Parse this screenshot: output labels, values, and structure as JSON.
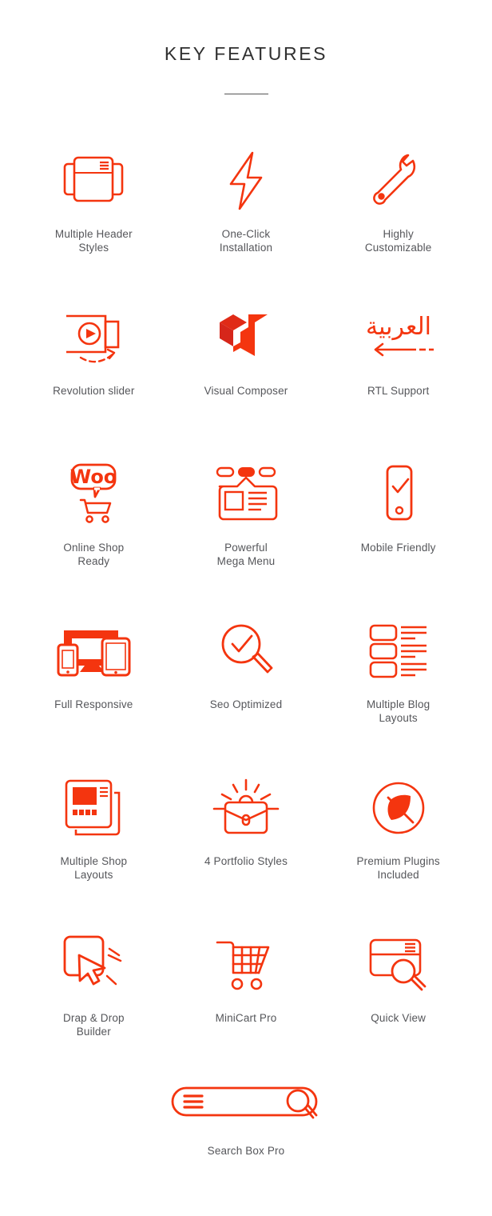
{
  "header": {
    "title": "KEY FEATURES"
  },
  "colors": {
    "accent": "#f4350f",
    "accent_dark": "#e8330f",
    "accent_light": "#ff4d17",
    "title": "#2f2f2f",
    "label": "#55565a",
    "background": "#ffffff"
  },
  "features": [
    {
      "id": "multiple-header-styles",
      "icon": "layout-stack-icon",
      "label": "Multiple Header\nStyles"
    },
    {
      "id": "one-click-installation",
      "icon": "lightning-bolt-icon",
      "label": "One-Click\nInstallation"
    },
    {
      "id": "highly-customizable",
      "icon": "wrench-icon",
      "label": "Highly\nCustomizable"
    },
    {
      "id": "revolution-slider",
      "icon": "slider-play-icon",
      "label": "Revolution slider"
    },
    {
      "id": "visual-composer",
      "icon": "visual-composer-logo-icon",
      "label": "Visual Composer"
    },
    {
      "id": "rtl-support",
      "icon": "arabic-rtl-arrow-icon",
      "label": "RTL Support"
    },
    {
      "id": "online-shop-ready",
      "icon": "woocommerce-cart-icon",
      "label": "Online Shop\nReady"
    },
    {
      "id": "powerful-mega-menu",
      "icon": "mega-menu-icon",
      "label": "Powerful\nMega Menu"
    },
    {
      "id": "mobile-friendly",
      "icon": "mobile-check-icon",
      "label": "Mobile Friendly"
    },
    {
      "id": "full-responsive",
      "icon": "responsive-devices-icon",
      "label": "Full Responsive"
    },
    {
      "id": "seo-optimized",
      "icon": "magnifier-check-icon",
      "label": "Seo Optimized"
    },
    {
      "id": "multiple-blog-layouts",
      "icon": "blog-list-icon",
      "label": "Multiple Blog\nLayouts"
    },
    {
      "id": "multiple-shop-layouts",
      "icon": "shop-pages-icon",
      "label": "Multiple Shop\nLayouts"
    },
    {
      "id": "4-portfolio-styles",
      "icon": "briefcase-shine-icon",
      "label": "4 Portfolio Styles"
    },
    {
      "id": "premium-plugins",
      "icon": "plug-circle-icon",
      "label": "Premium Plugins\nIncluded"
    },
    {
      "id": "drag-drop-builder",
      "icon": "cursor-box-icon",
      "label": "Drap & Drop\nBuilder"
    },
    {
      "id": "minicart-pro",
      "icon": "shopping-cart-grid-icon",
      "label": "MiniCart Pro"
    },
    {
      "id": "quick-view",
      "icon": "card-magnifier-icon",
      "label": "Quick View"
    }
  ],
  "feature_wide": {
    "id": "search-box-pro",
    "icon": "search-bar-icon",
    "label": "Search Box Pro"
  },
  "rtl_icon": {
    "arabic_word": "العربية"
  }
}
